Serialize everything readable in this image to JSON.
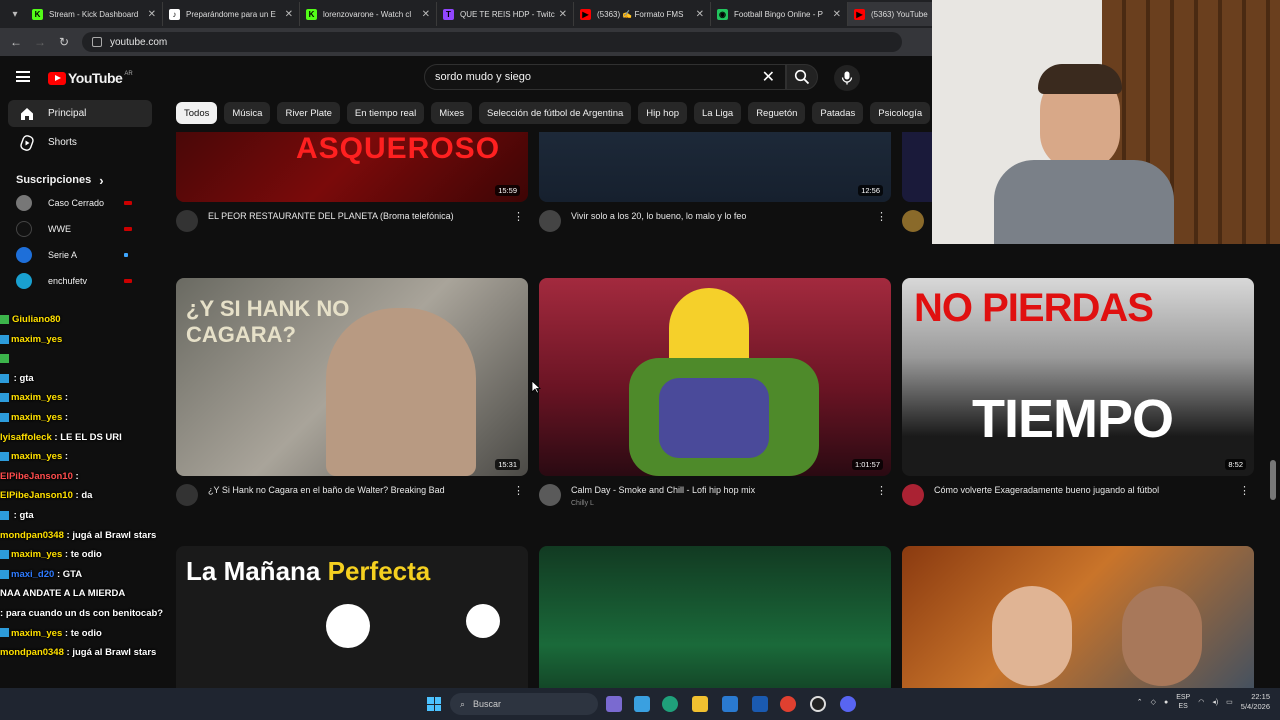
{
  "browser": {
    "tabs": [
      {
        "title": "Stream - Kick Dashboard",
        "color": "#53fc18",
        "letter": "K"
      },
      {
        "title": "Preparándome para un E",
        "color": "#ffffff",
        "letter": "♪"
      },
      {
        "title": "lorenzovarone - Watch cl",
        "color": "#53fc18",
        "letter": "K"
      },
      {
        "title": "QUE TE REIS HDP - Twitch",
        "color": "#9146ff",
        "letter": "T"
      },
      {
        "title": "(5363) ✍ Formato FMS",
        "color": "#ff0000",
        "letter": "▶"
      },
      {
        "title": "Football Bingo Online - P",
        "color": "#22c55e",
        "letter": "◉"
      },
      {
        "title": "(5363) YouTube",
        "color": "#ff0000",
        "letter": "▶"
      }
    ],
    "url": "youtube.com"
  },
  "header": {
    "logo_text": "YouTube",
    "country": "AR",
    "search_value": "sordo mudo y siego",
    "clear_glyph": "✕"
  },
  "sidebar": {
    "items": [
      {
        "label": "Principal"
      },
      {
        "label": "Shorts"
      }
    ],
    "subs_title": "Suscripciones",
    "subs_arrow": "›",
    "subscriptions": [
      {
        "name": "Caso Cerrado",
        "color": "#777777"
      },
      {
        "name": "WWE",
        "color": "#111111"
      },
      {
        "name": "Serie A",
        "color": "#1e6fd9"
      },
      {
        "name": "enchufetv",
        "color": "#19a0d0"
      }
    ]
  },
  "chips": [
    "Todos",
    "Música",
    "River Plate",
    "En tiempo real",
    "Mixes",
    "Selección de fútbol de Argentina",
    "Hip hop",
    "La Liga",
    "Reguetón",
    "Patadas",
    "Psicología"
  ],
  "videos": [
    {
      "title": "EL PEOR RESTAURANTE DEL PLANETA (Broma telefónica)",
      "duration": "15:59",
      "channel": "",
      "stats": ""
    },
    {
      "title": "Vivir solo a los 20, lo bueno, lo malo y lo feo",
      "duration": "12:56",
      "channel": "",
      "stats": ""
    },
    {
      "title": "",
      "duration": "",
      "channel": "",
      "stats": ""
    },
    {
      "title": "¿Y Si Hank no Cagara en el baño de Walter? Breaking Bad",
      "duration": "15:31",
      "channel": "",
      "stats": "",
      "thumb_text": "¿Y SI HANK NO CAGARA?"
    },
    {
      "title": "Calm Day - Smoke and Chill - Lofi hip hop mix",
      "duration": "1:01:57",
      "channel": "Chilly L",
      "stats": ""
    },
    {
      "title": "Cómo volverte Exageradamente bueno jugando al fútbol",
      "duration": "8:52",
      "channel": "",
      "stats": "",
      "thumb_text_top": "NO PIERDAS",
      "thumb_text_bottom": "TIEMPO"
    },
    {
      "title": "",
      "duration": "",
      "channel": "",
      "stats": "",
      "thumb_text_a": "La Mañana",
      "thumb_text_b": "Perfecta"
    },
    {
      "title": "",
      "duration": "",
      "channel": "",
      "stats": ""
    },
    {
      "title": "",
      "duration": "",
      "channel": "",
      "stats": ""
    }
  ],
  "thumb1_text": "ASQUEROSO",
  "chat": [
    {
      "user": "Giuliano80",
      "msg": "",
      "ucolor": "#ffe000"
    },
    {
      "user": "maxim_yes",
      "msg": "",
      "ucolor": "#ffe000"
    },
    {
      "user": "",
      "msg": "",
      "ucolor": "#ff4d4d"
    },
    {
      "user": "",
      "msg": "gta",
      "ucolor": "#2f7bff"
    },
    {
      "user": "maxim_yes",
      "msg": "",
      "ucolor": "#ffe000"
    },
    {
      "user": "maxim_yes",
      "msg": "",
      "ucolor": "#ffe000"
    },
    {
      "user": "lyisaffoleck",
      "msg": "LE EL DS URI",
      "ucolor": "#ffe000"
    },
    {
      "user": "maxim_yes",
      "msg": "",
      "ucolor": "#ffe000"
    },
    {
      "user": "ElPibeJanson10",
      "msg": "",
      "ucolor": "#ff4d4d"
    },
    {
      "user": "ElPibeJanson10",
      "msg": "da",
      "ucolor": "#ffe000"
    },
    {
      "user": "",
      "msg": "gta",
      "ucolor": "#2f7bff"
    },
    {
      "user": "mondpan0348",
      "msg": "jugá al Brawl stars",
      "ucolor": "#ffe000"
    },
    {
      "user": "maxim_yes",
      "msg": "te odio",
      "ucolor": "#ffe000"
    },
    {
      "user": "maxi_d20",
      "msg": "GTA",
      "ucolor": "#2f7bff"
    },
    {
      "user": "",
      "msg": "NAA ANDATE A LA MIERDA",
      "ucolor": "#ff4d4d"
    },
    {
      "user": "",
      "msg": "para cuando un ds con benitocab?",
      "ucolor": "#ff4d4d"
    },
    {
      "user": "maxim_yes",
      "msg": "te odio",
      "ucolor": "#ffe000"
    },
    {
      "user": "mondpan0348",
      "msg": "jugá al Brawl stars",
      "ucolor": "#ffe000"
    }
  ],
  "taskbar": {
    "search_label": "Buscar",
    "lang": "ESP",
    "region": "ES",
    "time": "22:15",
    "date": "5/4/2026"
  }
}
